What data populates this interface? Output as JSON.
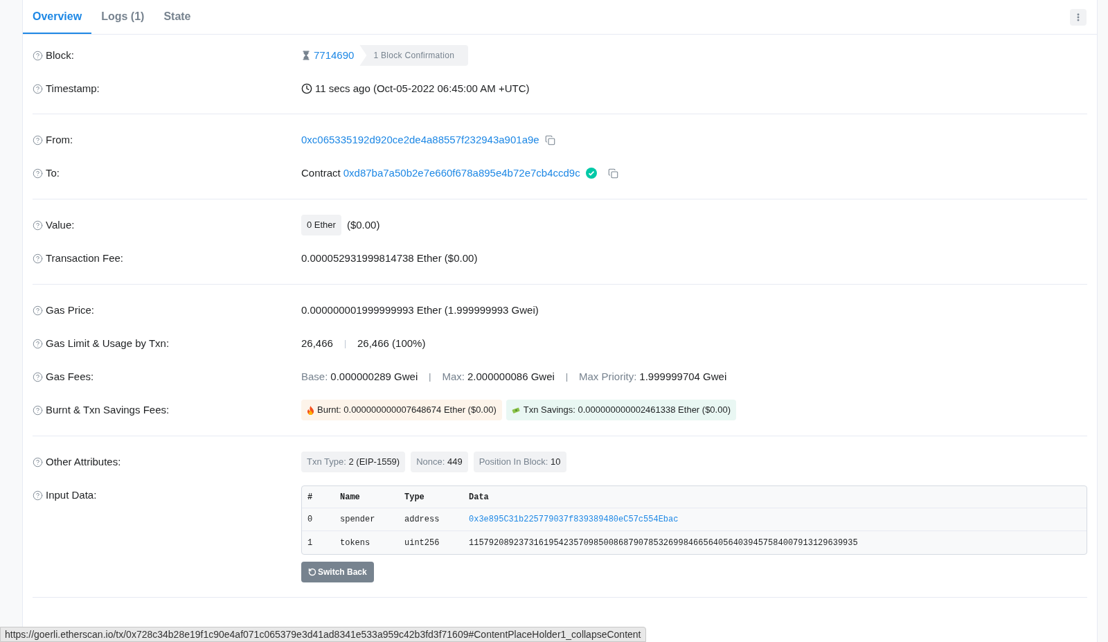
{
  "tabs": [
    {
      "label": "Overview",
      "selected": true
    },
    {
      "label": "Logs (1)",
      "selected": false
    },
    {
      "label": "State",
      "selected": false
    }
  ],
  "sections": [
    {
      "rows": [
        {
          "kind": "block",
          "label": "Block:",
          "value": "7714690",
          "badge": "1 Block Confirmation"
        },
        {
          "kind": "timestamp",
          "label": "Timestamp:",
          "value": "11 secs ago (Oct-05-2022 06:45:00 AM +UTC)"
        }
      ]
    },
    {
      "rows": [
        {
          "kind": "address",
          "label": "From:",
          "value": "0xc065335192d920ce2de4a88557f232943a901a9e"
        },
        {
          "kind": "contract",
          "label": "To:",
          "prefix": "Contract",
          "value": "0xd87ba7a50b2e7e660f678a895e4b72e7cb4ccd9c",
          "verified": true
        }
      ]
    },
    {
      "rows": [
        {
          "kind": "value",
          "label": "Value:",
          "badge": "0 Ether",
          "value": "($0.00)"
        },
        {
          "kind": "text",
          "label": "Transaction Fee:",
          "value": "0.000052931999814738 Ether ($0.00)"
        }
      ]
    },
    {
      "rows": [
        {
          "kind": "text",
          "label": "Gas Price:",
          "value": "0.000000001999999993 Ether (1.999999993 Gwei)"
        },
        {
          "kind": "usage",
          "label": "Gas Limit & Usage by Txn:",
          "limit": "26,466",
          "separator": "|",
          "usage": "26,466 (100%)"
        },
        {
          "kind": "gas_fees",
          "label": "Gas Fees:",
          "parts": [
            {
              "name": "Base:",
              "value": "0.000000289 Gwei"
            },
            {
              "name": "Max:",
              "value": "2.000000086 Gwei"
            },
            {
              "name": "Max Priority:",
              "value": "1.999999704 Gwei"
            }
          ],
          "separator": "|"
        },
        {
          "kind": "fees",
          "label": "Burnt & Txn Savings Fees:",
          "burnt": "Burnt: 0.000000000007648674 Ether ($0.00)",
          "savings": "Txn Savings: 0.000000000002461338 Ether ($0.00)"
        }
      ]
    },
    {
      "rows": [
        {
          "kind": "attributes",
          "label": "Other Attributes:",
          "items": [
            {
              "name": "Txn Type:",
              "value": "2 (EIP-1559)"
            },
            {
              "name": "Nonce:",
              "value": "449"
            },
            {
              "name": "Position In Block:",
              "value": "10"
            }
          ]
        },
        {
          "kind": "input",
          "label": "Input Data:",
          "columns": [
            "#",
            "Name",
            "Type",
            "Data"
          ],
          "rows": [
            {
              "index": "0",
              "name": "spender",
              "type": "address",
              "data": "0x3e895C31b225779037f839389480eC57c554Ebac",
              "link": true
            },
            {
              "index": "1",
              "name": "tokens",
              "type": "uint256",
              "data": "115792089237316195423570985008687907853269984665640564039457584007913129639935",
              "link": false
            }
          ],
          "button": "Switch Back"
        }
      ]
    }
  ],
  "status_bar": "https://goerli.etherscan.io/tx/0x728c34b28e19f1c90e4af071c065379e3d41ad8341e533a959c42b3fd3f71609#ContentPlaceHolder1_collapseContent"
}
